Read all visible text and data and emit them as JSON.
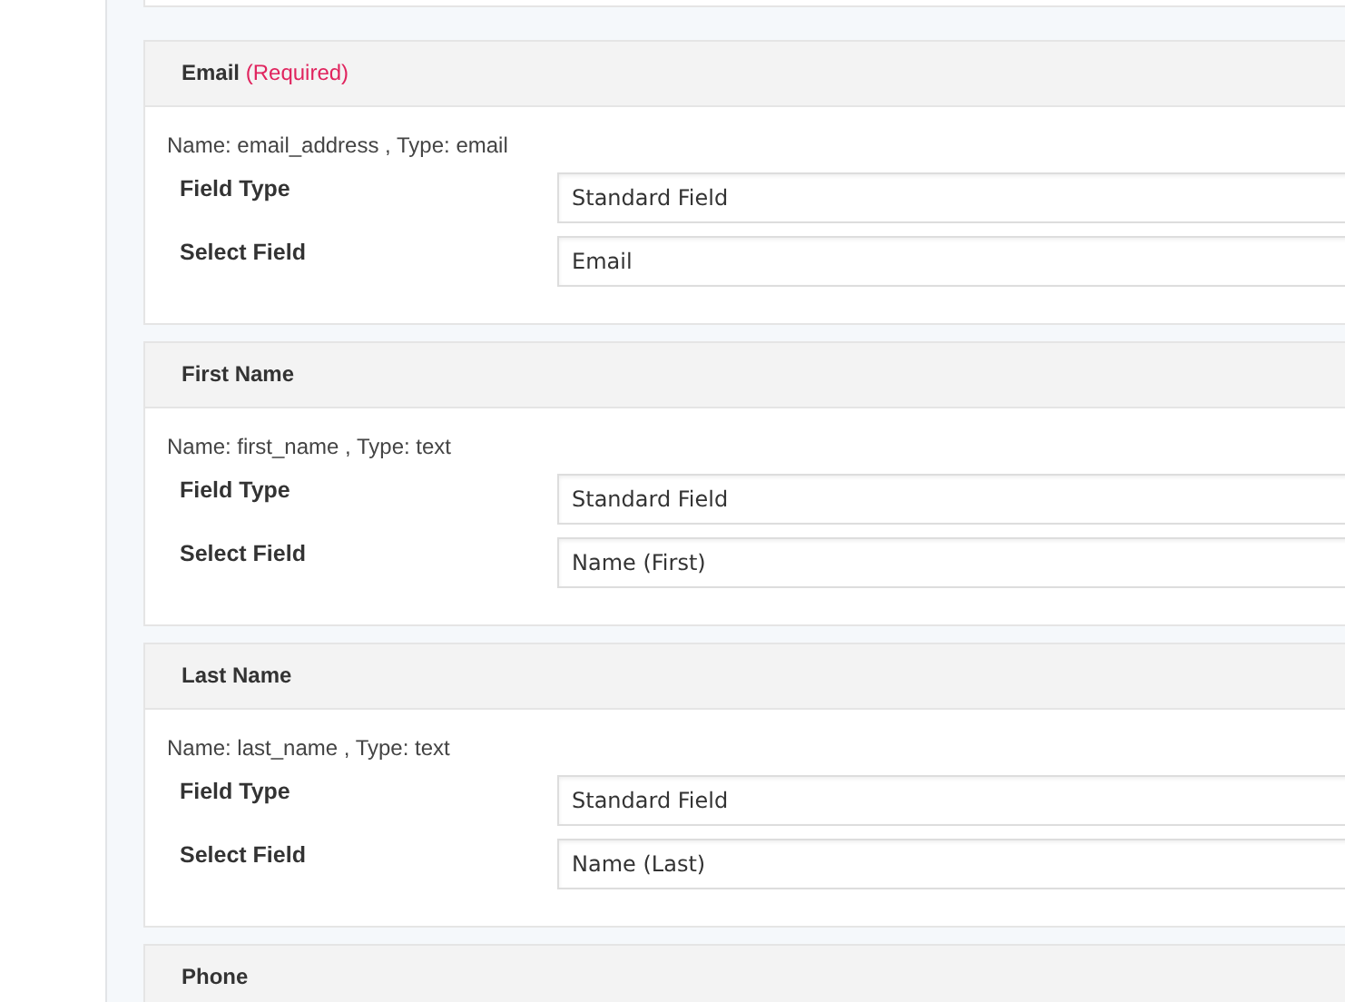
{
  "sections": [
    {
      "title": "Email",
      "required_note": "(Required)",
      "meta": "Name: email_address , Type: email",
      "fields": [
        {
          "label": "Field Type",
          "value": "Standard Field"
        },
        {
          "label": "Select Field",
          "value": "Email"
        }
      ]
    },
    {
      "title": "First Name",
      "meta": "Name: first_name , Type: text",
      "fields": [
        {
          "label": "Field Type",
          "value": "Standard Field"
        },
        {
          "label": "Select Field",
          "value": "Name (First)"
        }
      ]
    },
    {
      "title": "Last Name",
      "meta": "Name: last_name , Type: text",
      "fields": [
        {
          "label": "Field Type",
          "value": "Standard Field"
        },
        {
          "label": "Select Field",
          "value": "Name (Last)"
        }
      ]
    },
    {
      "title": "Phone"
    }
  ]
}
